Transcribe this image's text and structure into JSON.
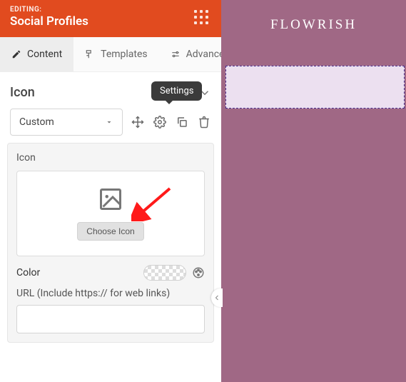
{
  "header": {
    "editing_label": "EDITING:",
    "title": "Social Profiles"
  },
  "tabs": [
    {
      "label": "Content",
      "active": true
    },
    {
      "label": "Templates",
      "active": false
    },
    {
      "label": "Advanced",
      "active": false
    }
  ],
  "section": {
    "title": "Icon"
  },
  "select": {
    "value": "Custom"
  },
  "tooltip": {
    "settings": "Settings"
  },
  "card": {
    "label": "Icon",
    "choose_button": "Choose Icon",
    "color_label": "Color",
    "url_label": "URL (Include https:// for web links)",
    "url_value": ""
  },
  "preview": {
    "brand": "FLOWRISH"
  }
}
